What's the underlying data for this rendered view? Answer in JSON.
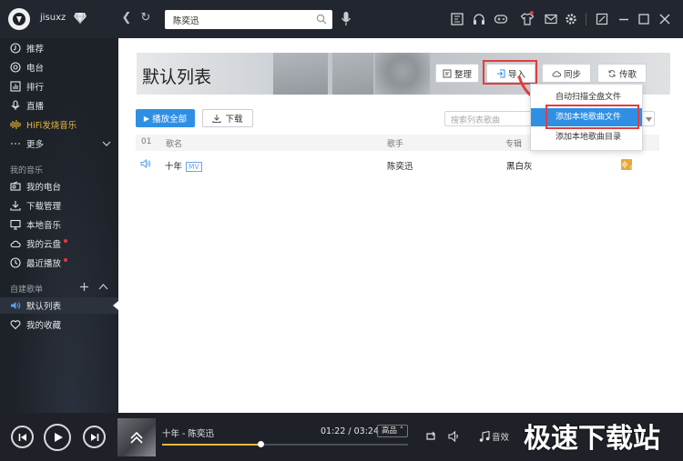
{
  "user": {
    "name": "jisuxz"
  },
  "search": {
    "value": "陈奕迅"
  },
  "sidebar": {
    "nav": [
      {
        "label": "推荐",
        "icon": "recommend-icon"
      },
      {
        "label": "电台",
        "icon": "radio-icon"
      },
      {
        "label": "排行",
        "icon": "chart-icon"
      },
      {
        "label": "直播",
        "icon": "live-icon"
      },
      {
        "label": "HiFi发烧音乐",
        "icon": "hifi-icon"
      },
      {
        "label": "更多",
        "icon": "more-icon"
      }
    ],
    "my_music_heading": "我的音乐",
    "my_music": [
      {
        "label": "我的电台",
        "icon": "my-radio-icon"
      },
      {
        "label": "下载管理",
        "icon": "download-icon"
      },
      {
        "label": "本地音乐",
        "icon": "monitor-icon"
      },
      {
        "label": "我的云盘",
        "icon": "cloud-icon"
      },
      {
        "label": "最近播放",
        "icon": "clock-icon"
      }
    ],
    "playlists_heading": "自建歌单",
    "playlists": [
      {
        "label": "默认列表",
        "icon": "speaker-icon"
      },
      {
        "label": "我的收藏",
        "icon": "heart-icon"
      }
    ]
  },
  "main": {
    "title": "默认列表",
    "buttons": {
      "organize": "整理",
      "import": "导入",
      "sync": "同步",
      "share": "传歌"
    },
    "import_menu": [
      "自动扫描全盘文件",
      "添加本地歌曲文件",
      "添加本地歌曲目录"
    ],
    "play_all": "播放全部",
    "download": "下载",
    "list_search_placeholder": "搜索列表歌曲",
    "columns": {
      "index": "01",
      "name": "歌名",
      "artist": "歌手",
      "album": "专辑"
    },
    "songs": [
      {
        "name": "十年",
        "mv": "MV",
        "artist": "陈奕迅",
        "album": "黑白灰",
        "tag": "无损"
      }
    ]
  },
  "player": {
    "now_playing": "十年 - 陈奕迅",
    "time": "01:22 / 03:24",
    "quality": "高品",
    "effect": "音效",
    "progress": 0.4
  },
  "watermark": "极速下载站",
  "colors": {
    "accent": "#2f8fe4",
    "highlight": "#e23d3d",
    "tag": "#e4a93c",
    "hifi": "#e7b83b"
  }
}
